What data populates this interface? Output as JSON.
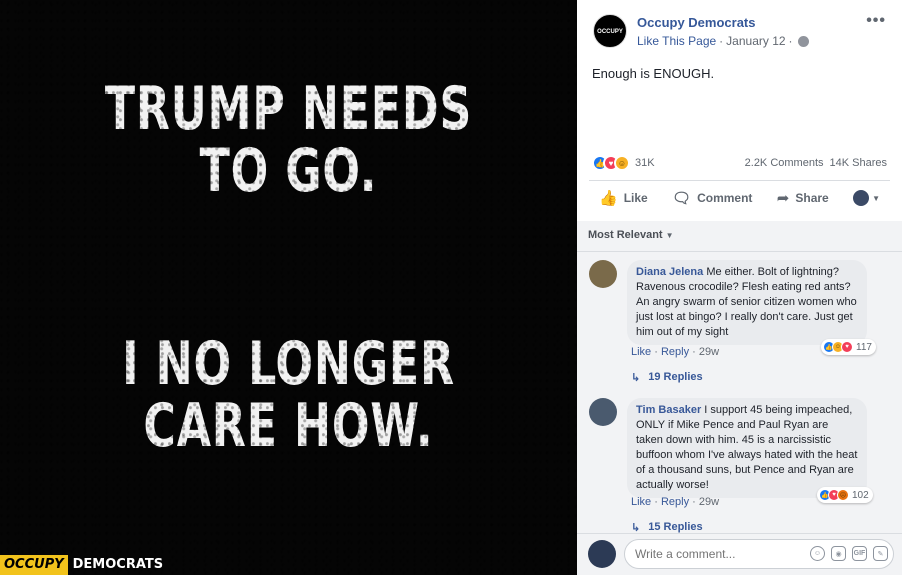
{
  "poster": {
    "lines_top": [
      "TRUMP NEEDS",
      "TO GO."
    ],
    "lines_bottom": [
      "I NO LONGER",
      "CARE HOW."
    ],
    "brand_a": "OCCUPY",
    "brand_b": "DEMOCRATS"
  },
  "post": {
    "page_avatar_text": "OCCUPY",
    "page_name": "Occupy Democrats",
    "like_page": "Like This Page",
    "separator": "·",
    "date": "January 12",
    "text": "Enough is ENOUGH.",
    "reaction_count": "31K",
    "comments_count": "2.2K Comments",
    "shares_count": "14K Shares"
  },
  "actions": {
    "like": "Like",
    "comment": "Comment",
    "share": "Share"
  },
  "comments": {
    "sort_label": "Most Relevant",
    "items": [
      {
        "author": "Diana Jelena",
        "text": "Me either. Bolt of lightning? Ravenous crocodile? Flesh eating red ants? An angry swarm of senior citizen women who just lost at bingo? I really don't care. Just get him out of my sight",
        "reactions": "117",
        "like": "Like",
        "reply": "Reply",
        "sep": "·",
        "age": "29w",
        "replies": "19 Replies"
      },
      {
        "author": "Tim Basaker",
        "text": "I support 45 being impeached, ONLY if Mike Pence and Paul Ryan are taken down with him. 45 is a narcissistic buffoon whom I've always hated with the heat of a thousand suns, but Pence and Ryan are actually worse!",
        "reactions": "102",
        "like": "Like",
        "reply": "Reply",
        "sep": "·",
        "age": "29w",
        "replies": "15 Replies"
      }
    ]
  },
  "composer": {
    "placeholder": "Write a comment...",
    "gif_label": "GIF"
  },
  "colors": {
    "fb_blue": "#365899",
    "brand_yellow": "#f2c31c",
    "like_blue": "#1877f2",
    "love_red": "#f33e58"
  }
}
